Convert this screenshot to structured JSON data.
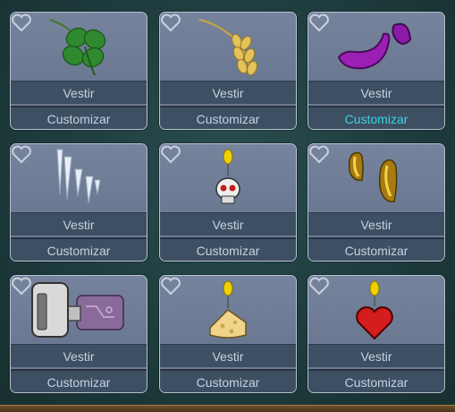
{
  "wear_label": "Vestir",
  "customize_label": "Customizar",
  "colors": {
    "active_customize": "#35d6de",
    "button_text": "#c7d2e0"
  },
  "items": [
    {
      "art": "clover-icon",
      "favorite_icon": "heart-outline-icon",
      "customize_active": false
    },
    {
      "art": "wheat-icon",
      "favorite_icon": "heart-outline-icon",
      "customize_active": false
    },
    {
      "art": "purple-shadow-icon",
      "favorite_icon": "heart-outline-icon",
      "customize_active": true
    },
    {
      "art": "icicles-icon",
      "favorite_icon": "heart-outline-icon",
      "customize_active": false
    },
    {
      "art": "skull-earring-icon",
      "favorite_icon": "heart-outline-icon",
      "customize_active": false
    },
    {
      "art": "gold-hoops-icon",
      "favorite_icon": "heart-outline-icon",
      "customize_active": false
    },
    {
      "art": "memory-card-icon",
      "favorite_icon": "heart-outline-icon",
      "customize_active": false
    },
    {
      "art": "cheese-earring-icon",
      "favorite_icon": "heart-outline-icon",
      "customize_active": false
    },
    {
      "art": "heart-earring-icon",
      "favorite_icon": "heart-outline-icon",
      "customize_active": false
    }
  ]
}
